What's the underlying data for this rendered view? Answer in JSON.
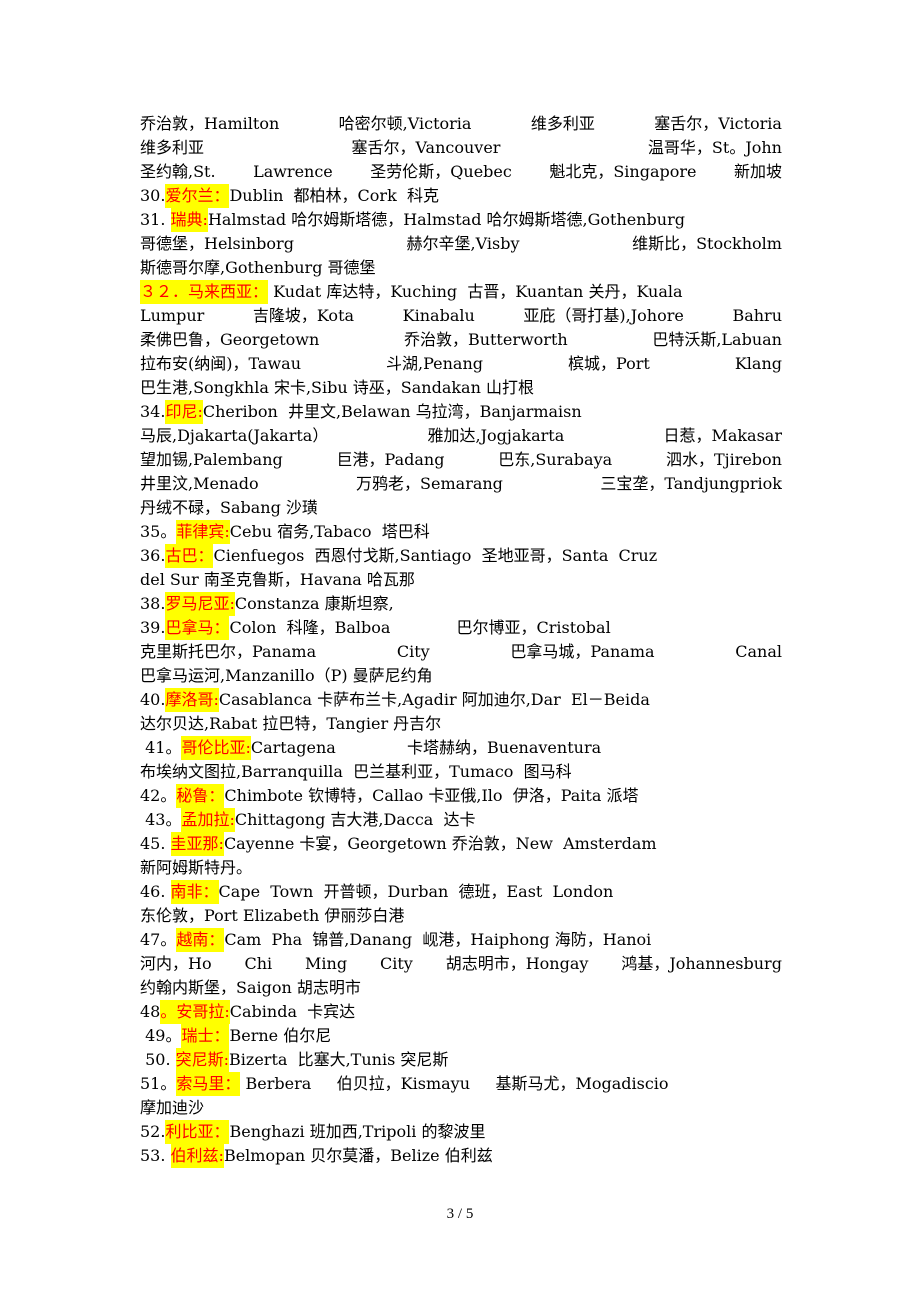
{
  "document": {
    "lines": [
      {
        "segments": [
          "乔治敦，Hamilton  哈密尔顿,Victoria  维多利亚  塞舌尔，Victoria"
        ],
        "justify": true
      },
      {
        "segments": [
          "维多利亚        塞舌尔，Vancouver            温哥华，St。John"
        ],
        "justify": true
      },
      {
        "segments": [
          "圣约翰,St. Lawrence 圣劳伦斯，Quebec 魁北克，Singapore 新加坡"
        ],
        "justify": true
      },
      {
        "number": "30.",
        "country": "爱尔兰：",
        "text": "Dublin  都柏林，Cork  科克"
      },
      {
        "number": "31. ",
        "country": "瑞典:",
        "text": "Halmstad 哈尔姆斯塔德，Halmstad 哈尔姆斯塔德,Gothenburg"
      },
      {
        "segments": [
          "哥德堡，Helsinborg     赫尔辛堡,Visby     维斯比，Stockholm"
        ],
        "justify": true
      },
      {
        "segments": [
          "斯德哥尔摩,Gothenburg 哥德堡"
        ]
      },
      {
        "number_hl": "３２．",
        "country": "马来西亚：",
        "text": " Kudat 库达特，Kuching  古晋，Kuantan 关丹，Kuala"
      },
      {
        "segments": [
          "Lumpur  吉隆坡，Kota    Kinabalu  亚庇（哥打基),Johore  Bahru"
        ],
        "justify": true
      },
      {
        "segments": [
          "柔佛巴鲁，Georgetown  乔治敦，Butterworth          巴特沃斯,Labuan"
        ],
        "justify": true
      },
      {
        "segments": [
          "拉布安(纳闽)，Tawau        斗湖,Penang  槟城，Port         Klang"
        ],
        "justify": true
      },
      {
        "segments": [
          "巴生港,Songkhla 宋卡,Sibu 诗巫，Sandakan 山打根"
        ]
      },
      {
        "number": "34.",
        "country": "印尼:",
        "text": "Cheribon  井里文,Belawan 乌拉湾，Banjarmaisn"
      },
      {
        "segments": [
          "马辰,Djakarta(Jakarta）    雅加达,Jogjakarta    日惹，Makasar"
        ],
        "justify": true
      },
      {
        "segments": [
          "望加锡,Palembang  巨港，Padang 巴东,Surabaya 泗水，Tjirebon"
        ],
        "justify": true
      },
      {
        "segments": [
          "井里汶,Menado    万鸦老，Semarang     三宝垄，Tandjungpriok"
        ],
        "justify": true
      },
      {
        "segments": [
          "丹绒不碌，Sabang 沙璜"
        ]
      },
      {
        "number": "35。",
        "country": "菲律宾:",
        "text": "Cebu 宿务,Tabaco  塔巴科"
      },
      {
        "number": "36.",
        "country": "古巴：",
        "text": "Cienfuegos  西恩付戈斯,Santiago  圣地亚哥，Santa  Cruz"
      },
      {
        "segments": [
          "del Sur 南圣克鲁斯，Havana 哈瓦那"
        ]
      },
      {
        "number": "38.",
        "country": "罗马尼亚:",
        "text": "Constanza 康斯坦察,"
      },
      {
        "number": "39.",
        "country": "巴拿马：",
        "text": "Colon  科隆，Balboa             巴尔博亚，Cristobal"
      },
      {
        "segments": [
          "克里斯托巴尔，Panama  City      巴拿马城，Panama      Canal"
        ],
        "justify": true
      },
      {
        "segments": [
          "巴拿马运河,Manzanillo（P) 曼萨尼约角"
        ]
      },
      {
        "number": "40.",
        "country": "摩洛哥:",
        "text": "Casablanca 卡萨布兰卡,Agadir 阿加迪尔,Dar  El－Beida"
      },
      {
        "segments": [
          "达尔贝达,Rabat 拉巴特，Tangier 丹吉尔"
        ]
      },
      {
        "number": " 41。",
        "country": "哥伦比亚:",
        "text": "Cartagena              卡塔赫纳，Buenaventura"
      },
      {
        "segments": [
          "布埃纳文图拉,Barranquilla  巴兰基利亚，Tumaco  图马科"
        ]
      },
      {
        "number": "42。",
        "country": "秘鲁：",
        "text": "Chimbote 钦博特，Callao 卡亚俄,Ilo  伊洛，Paita 派塔"
      },
      {
        "number": " 43。",
        "country": "孟加拉:",
        "text": "Chittagong 吉大港,Dacca  达卡"
      },
      {
        "number": "45. ",
        "country": "圭亚那:",
        "text": "Cayenne 卡宴，Georgetown 乔治敦，New  Amsterdam"
      },
      {
        "segments": [
          "新阿姆斯特丹。"
        ]
      },
      {
        "number": "46. ",
        "country": "南非：",
        "text": "Cape  Town  开普顿，Durban  德班，East  London"
      },
      {
        "segments": [
          "东伦敦，Port Elizabeth 伊丽莎白港"
        ]
      },
      {
        "number": "47。",
        "country": "越南：",
        "text": "Cam  Pha  锦普,Danang  岘港，Haiphong 海防，Hanoi"
      },
      {
        "segments": [
          "河内，Ho Chi  Ming  City  胡志明市，Hongay  鸿基，Johannesburg"
        ],
        "justify": true
      },
      {
        "segments": [
          "约翰内斯堡，Saigon 胡志明市"
        ]
      },
      {
        "number": "48",
        "country": "。安哥拉:",
        "text": "Cabinda  卡宾达"
      },
      {
        "number": " 49。",
        "country": "瑞士：",
        "text": "Berne 伯尔尼"
      },
      {
        "number": " 50. ",
        "country": "突尼斯:",
        "text": "Bizerta  比塞大,Tunis 突尼斯"
      },
      {
        "number": "51。",
        "country": "索马里：",
        "text": " Berbera     伯贝拉，Kismayu     基斯马尤，Mogadiscio"
      },
      {
        "segments": [
          "摩加迪沙"
        ]
      },
      {
        "number": "52.",
        "country": "利比亚：",
        "text": "Benghazi 班加西,Tripoli 的黎波里"
      },
      {
        "number": "53. ",
        "country": "伯利兹:",
        "text": "Belmopan 贝尔莫潘，Belize 伯利兹"
      }
    ]
  },
  "footer": {
    "page_indicator": "3 / 5"
  },
  "colors": {
    "highlight": "#ffff00",
    "country_text": "#ff0000",
    "body_text": "#000000"
  }
}
